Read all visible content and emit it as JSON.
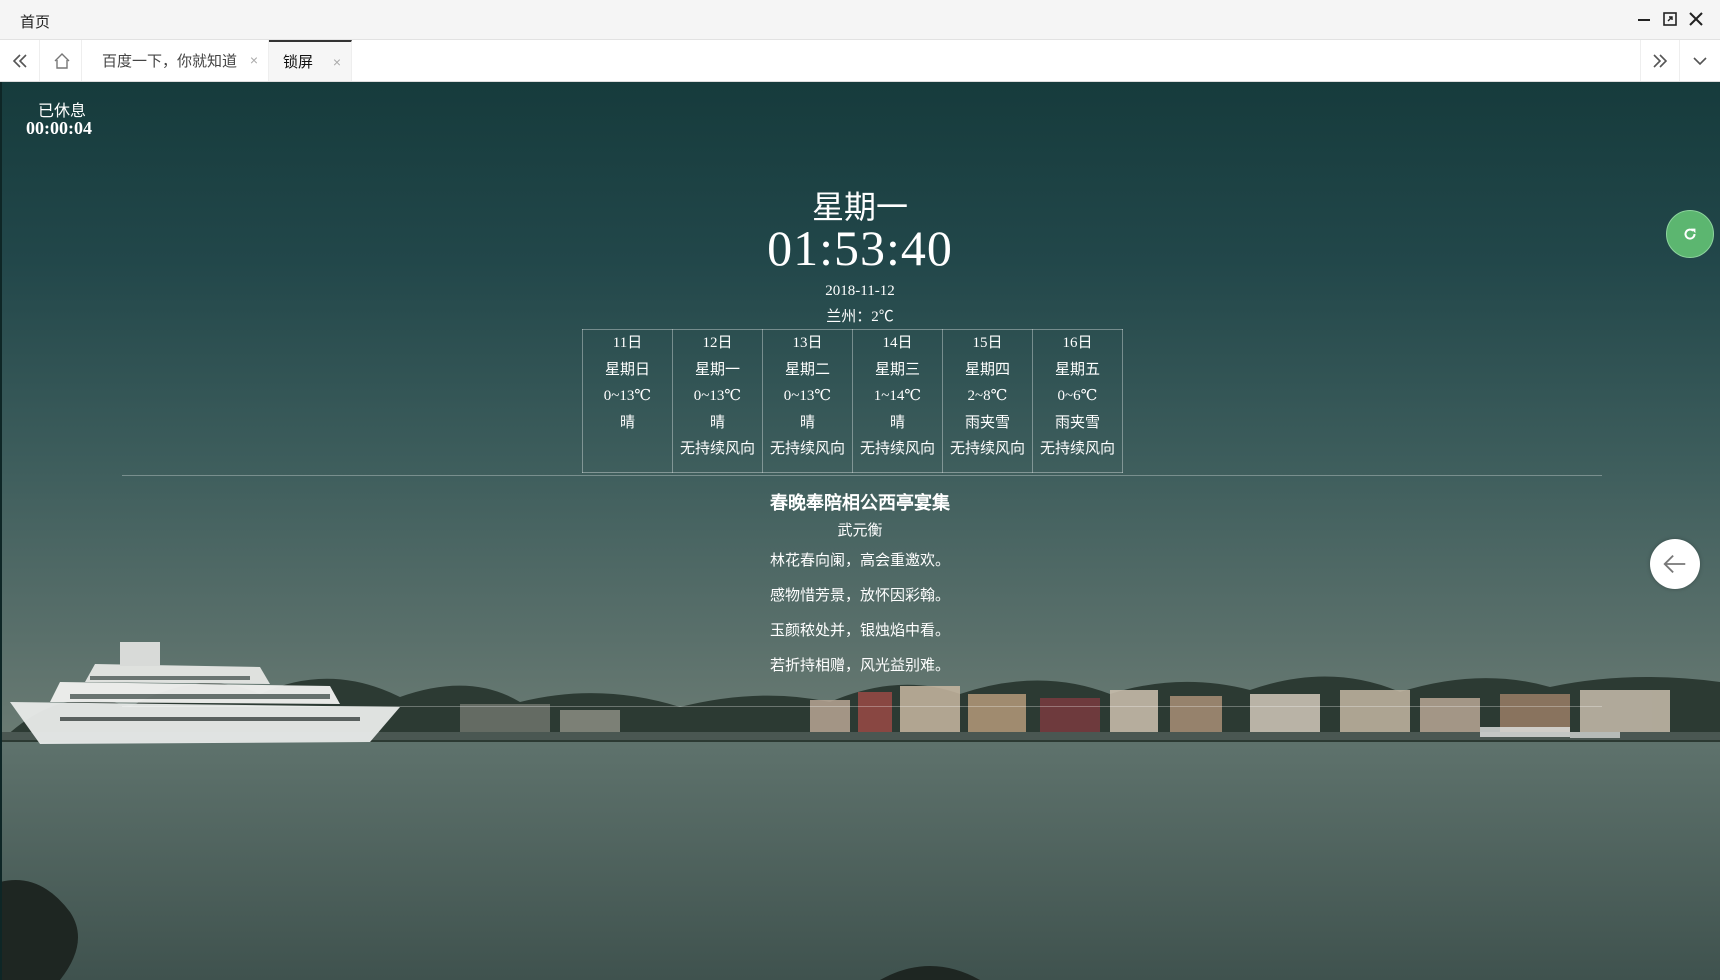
{
  "window": {
    "title": "首页"
  },
  "tabs": [
    {
      "label": "百度一下，你就知道",
      "close": "×",
      "active": false
    },
    {
      "label": "锁屏",
      "close": "×",
      "active": true
    }
  ],
  "rest": {
    "label": "已休息",
    "elapsed": "00:00:04"
  },
  "clock": {
    "weekday": "星期一",
    "time": "01:53:40",
    "date": "2018-11-12",
    "city_weather": "兰州：2℃"
  },
  "forecast": [
    {
      "day": "11日",
      "weekday": "星期日",
      "temp": "0~13℃",
      "weather": "晴",
      "wind": ""
    },
    {
      "day": "12日",
      "weekday": "星期一",
      "temp": "0~13℃",
      "weather": "晴",
      "wind": "无持续风向"
    },
    {
      "day": "13日",
      "weekday": "星期二",
      "temp": "0~13℃",
      "weather": "晴",
      "wind": "无持续风向"
    },
    {
      "day": "14日",
      "weekday": "星期三",
      "temp": "1~14℃",
      "weather": "晴",
      "wind": "无持续风向"
    },
    {
      "day": "15日",
      "weekday": "星期四",
      "temp": "2~8℃",
      "weather": "雨夹雪",
      "wind": "无持续风向"
    },
    {
      "day": "16日",
      "weekday": "星期五",
      "temp": "0~6℃",
      "weather": "雨夹雪",
      "wind": "无持续风向"
    }
  ],
  "poem": {
    "title": "春晚奉陪相公西亭宴集",
    "author": "武元衡",
    "lines": [
      "林花春向阑，高会重邀欢。",
      "感物惜芳景，放怀因彩翰。",
      "玉颜秾处并，银烛焰中看。",
      "若折持相赠，风光益别难。"
    ]
  },
  "icons": {
    "minimize": "minimize-icon",
    "maximize": "maximize-icon",
    "close": "close-icon",
    "back": "double-chevron-left-icon",
    "home": "home-icon",
    "scroll_right": "double-chevron-right-icon",
    "tab_menu": "chevron-down-icon",
    "refresh": "refresh-icon",
    "arrow_left": "arrow-left-icon"
  },
  "colors": {
    "refresh_button": "#5cb670",
    "active_tab_border": "#333333"
  }
}
